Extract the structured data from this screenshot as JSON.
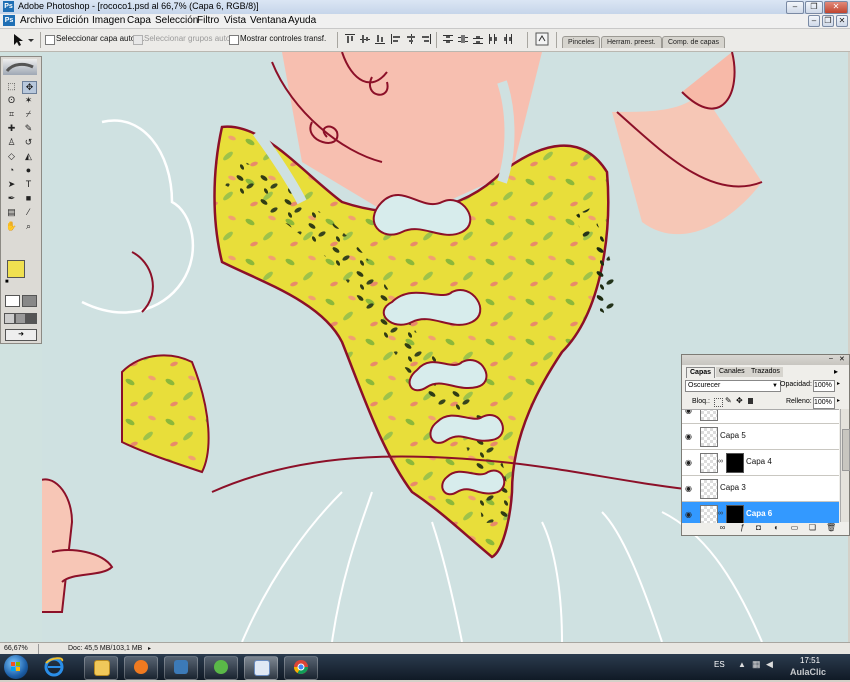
{
  "window": {
    "title": "Adobe Photoshop - [rococo1.psd al 66,7% (Capa 6, RGB/8)]",
    "app_icon": "Ps",
    "controls": [
      "minimize-icon",
      "restore-icon",
      "close-icon"
    ]
  },
  "menu": {
    "items": [
      "Archivo",
      "Edición",
      "Imagen",
      "Capa",
      "Selección",
      "Filtro",
      "Vista",
      "Ventana",
      "Ayuda"
    ]
  },
  "options_bar": {
    "auto_select_layer": "Seleccionar capa autom.",
    "auto_select_groups": "Seleccionar grupos autom.",
    "show_transform_controls": "Mostrar controles transf.",
    "well_tabs": [
      "Pinceles",
      "Herram. preest.",
      "Comp. de capas"
    ]
  },
  "toolbox": {
    "tools": [
      [
        "marquee-tool",
        "move-tool"
      ],
      [
        "lasso-tool",
        "magic-wand-tool"
      ],
      [
        "crop-tool",
        "slice-tool"
      ],
      [
        "healing-tool",
        "brush-tool"
      ],
      [
        "stamp-tool",
        "history-brush-tool"
      ],
      [
        "eraser-tool",
        "paint-bucket-tool"
      ],
      [
        "blur-tool",
        "dodge-tool"
      ],
      [
        "path-select-tool",
        "type-tool"
      ],
      [
        "pen-tool",
        "shape-tool"
      ],
      [
        "notes-tool",
        "eyedropper-tool"
      ],
      [
        "hand-tool",
        "zoom-tool"
      ]
    ],
    "foreground_color": "#f0e050",
    "background_color": "#e89c98"
  },
  "layers_panel": {
    "tabs": [
      "Capas",
      "Canales",
      "Trazados"
    ],
    "blend_mode": "Oscurecer",
    "opacity_label": "Opacidad:",
    "opacity_value": "100%",
    "lock_label": "Bloq.:",
    "fill_label": "Relleno:",
    "fill_value": "100%",
    "layers": [
      {
        "name": "",
        "has_mask": false,
        "selected": false
      },
      {
        "name": "Capa 5",
        "has_mask": false,
        "selected": false
      },
      {
        "name": "Capa 4",
        "has_mask": true,
        "selected": false
      },
      {
        "name": "Capa 3",
        "has_mask": false,
        "selected": false
      },
      {
        "name": "Capa 6",
        "has_mask": true,
        "selected": true
      }
    ]
  },
  "status_bar": {
    "zoom": "66,67%",
    "doc_info": "Doc: 45,5 MB/103,1 MB"
  },
  "taskbar": {
    "apps": [
      "start-orb",
      "ie-icon",
      "explorer-icon",
      "media-player-icon",
      "app-icon",
      "messenger-icon",
      "photoshop-icon",
      "chrome-icon"
    ],
    "language": "ES",
    "time": "17:51",
    "watermark": "AulaClic"
  }
}
